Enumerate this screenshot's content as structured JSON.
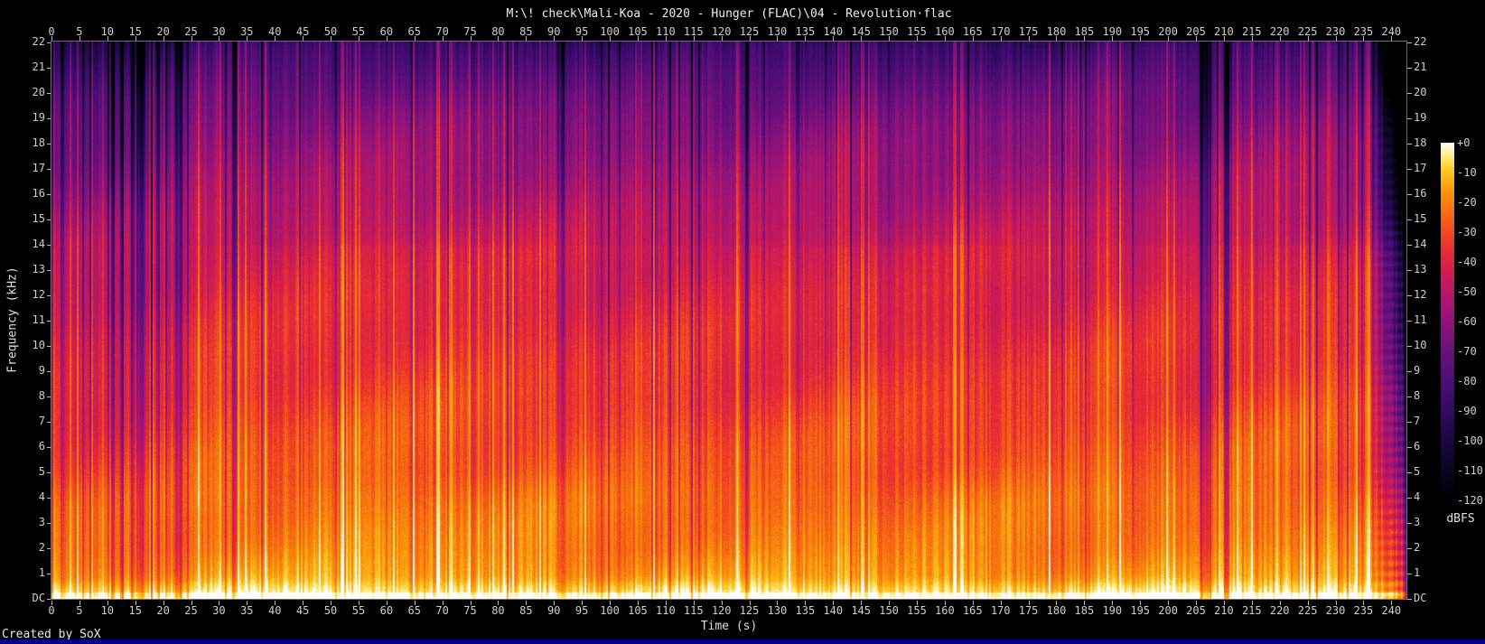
{
  "title": "M:\\! check\\Mali-Koa - 2020 - Hunger (FLAC)\\04 - Revolution·flac",
  "created_by": "Created by SoX",
  "footer_bar_color": "#000084",
  "axes": {
    "time": {
      "label": "Time (s)",
      "tick_labels": [
        "0",
        "5",
        "10",
        "15",
        "20",
        "25",
        "30",
        "35",
        "40",
        "45",
        "50",
        "55",
        "60",
        "65",
        "70",
        "75",
        "80",
        "85",
        "90",
        "95",
        "100",
        "105",
        "110",
        "115",
        "120",
        "125",
        "130",
        "135",
        "140",
        "145",
        "150",
        "155",
        "160",
        "165",
        "170",
        "175",
        "180",
        "185",
        "190",
        "195",
        "200",
        "205",
        "210",
        "215",
        "220",
        "225",
        "230",
        "235",
        "240"
      ]
    },
    "frequency": {
      "label": "Frequency (kHz)",
      "tick_labels_top_to_bottom": [
        "22",
        "21",
        "20",
        "19",
        "18",
        "17",
        "16",
        "15",
        "14",
        "13",
        "12",
        "11",
        "10",
        "9",
        "8",
        "7",
        "6",
        "5",
        "4",
        "3",
        "2",
        "1",
        "DC"
      ]
    }
  },
  "colorbar": {
    "unit_label": "dBFS",
    "tick_labels": [
      "+0",
      "-10",
      "-20",
      "-30",
      "-40",
      "-50",
      "-60",
      "-70",
      "-80",
      "-90",
      "-100",
      "-110",
      "-120"
    ],
    "gradient_stops": [
      [
        0.0,
        "#000000"
      ],
      [
        0.1,
        "#0d0628"
      ],
      [
        0.2,
        "#23094e"
      ],
      [
        0.3,
        "#410d72"
      ],
      [
        0.42,
        "#6b117e"
      ],
      [
        0.52,
        "#9a157a"
      ],
      [
        0.62,
        "#c91a5b"
      ],
      [
        0.7,
        "#ea2c33"
      ],
      [
        0.78,
        "#f65c17"
      ],
      [
        0.86,
        "#fb920b"
      ],
      [
        0.92,
        "#fdc71e"
      ],
      [
        0.96,
        "#feea78"
      ],
      [
        1.0,
        "#ffffff"
      ]
    ]
  },
  "chart_data": {
    "type": "heatmap",
    "subtype": "audio-spectrogram",
    "title": "M:\\! check\\Mali-Koa - 2020 - Hunger (FLAC)\\04 - Revolution·flac",
    "xlabel": "Time (s)",
    "ylabel": "Frequency (kHz)",
    "x_range_s": [
      0,
      242.7
    ],
    "x_tick_step_s": 5,
    "y_range_khz": [
      0,
      22.05
    ],
    "y_tick_step_khz": 1,
    "z_scale": {
      "label": "dBFS",
      "min": -120,
      "max": 0,
      "tick_step": 10
    },
    "grid": false,
    "legend_position": "right-colorbar",
    "approx_level_dbfs_by_khz": [
      [
        0,
        -8
      ],
      [
        0.4,
        -12
      ],
      [
        1,
        -20
      ],
      [
        2,
        -25
      ],
      [
        3,
        -27
      ],
      [
        4,
        -29
      ],
      [
        5,
        -33
      ],
      [
        6,
        -35
      ],
      [
        8,
        -40
      ],
      [
        10,
        -44
      ],
      [
        12,
        -48
      ],
      [
        14,
        -52
      ],
      [
        15,
        -56
      ],
      [
        16,
        -60
      ],
      [
        17,
        -64
      ],
      [
        18,
        -68
      ],
      [
        19,
        -72
      ],
      [
        20,
        -78
      ],
      [
        21,
        -86
      ],
      [
        22.05,
        -95
      ]
    ],
    "features": {
      "intro_sparse_percussion": {
        "start_s": 0,
        "end_s": 21.5
      },
      "quiet_gaps_s": [
        [
          21.9,
          23.6
        ],
        [
          205.5,
          207.3
        ],
        [
          209.8,
          211.4
        ]
      ],
      "fade_out": {
        "start_s": 235.9,
        "end_s": 242.7
      },
      "subtle_lowpass_shelf_khz": 14,
      "bright_bass_floor_khz": 0.8
    }
  }
}
